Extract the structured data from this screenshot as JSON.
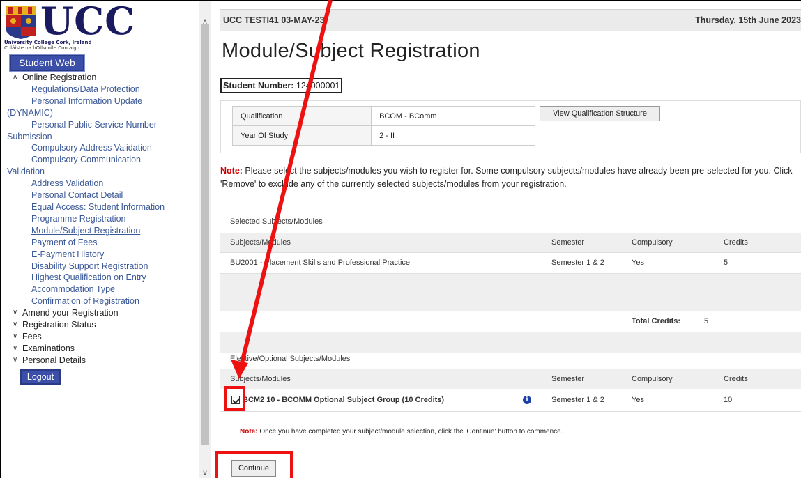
{
  "sidebar": {
    "logo_text": "UCC",
    "uni_name": "University College Cork, Ireland",
    "uni_irish": "Coláiste na hOllscoile Corcaigh",
    "student_web_label": "Student Web",
    "logout_label": "Logout",
    "sections": [
      {
        "label": "Online Registration",
        "expanded": true
      },
      {
        "label": "Amend your Registration",
        "expanded": false
      },
      {
        "label": "Registration Status",
        "expanded": false
      },
      {
        "label": "Fees",
        "expanded": false
      },
      {
        "label": "Examinations",
        "expanded": false
      },
      {
        "label": "Personal Details",
        "expanded": false
      }
    ],
    "items": [
      "Regulations/Data Protection",
      "Personal Information Update",
      "(DYNAMIC)",
      "Personal Public Service Number",
      "Submission",
      "Compulsory Address Validation",
      "Compulsory Communication",
      "Validation",
      "Address Validation",
      "Personal Contact Detail",
      "Equal Access: Student Information",
      "Programme Registration",
      "Module/Subject Registration",
      "Payment of Fees",
      "E-Payment History",
      "Disability Support Registration",
      "Highest Qualification on Entry",
      "Accommodation Type",
      "Confirmation of Registration"
    ]
  },
  "header": {
    "left": "UCC TESTI41 03-MAY-23",
    "right": "Thursday, 15th June 2023"
  },
  "page_title": "Module/Subject Registration",
  "student": {
    "label": "Student Number:",
    "value": "124000001"
  },
  "qualification": {
    "rows": [
      {
        "label": "Qualification",
        "value": "BCOM - BComm"
      },
      {
        "label": "Year Of Study",
        "value": "2 - II"
      }
    ],
    "view_button": "View Qualification Structure"
  },
  "note": {
    "label": "Note:",
    "text": " Please select the subjects/modules you wish to register for. Some compulsory subjects/modules have already been pre-selected for you. Click 'Remove' to exclude any of the currently selected subjects/modules from your registration."
  },
  "selected": {
    "title": "Selected Subjects/Modules",
    "headers": [
      "Subjects/Modules",
      "Semester",
      "Compulsory",
      "Credits"
    ],
    "rows": [
      {
        "subject": "BU2001 - Placement Skills and Professional Practice",
        "semester": "Semester 1 & 2",
        "compulsory": "Yes",
        "credits": "5"
      }
    ],
    "total_label": "Total Credits:",
    "total_value": "5"
  },
  "elective": {
    "title": "Elective/Optional Subjects/Modules",
    "headers": [
      "Subjects/Modules",
      "Semester",
      "Compulsory",
      "Credits"
    ],
    "rows": [
      {
        "subject": "BCM2 10 - BCOMM Optional Subject Group (10 Credits)",
        "semester": "Semester 1 & 2",
        "compulsory": "Yes",
        "credits": "10",
        "checked": true
      }
    ]
  },
  "note2": {
    "label": "Note:",
    "text": " Once you have completed your subject/module selection, click the 'Continue' button to commence."
  },
  "continue_label": "Continue",
  "colors": {
    "annotation": "#ee1111",
    "note_label": "#cc0000",
    "nav_link": "#3b5998",
    "button_blue": "#3b4fa8"
  }
}
